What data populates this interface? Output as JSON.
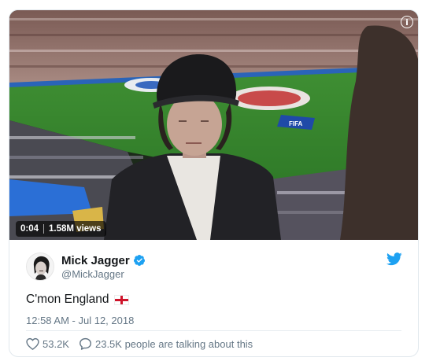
{
  "video": {
    "duration": "0:04",
    "views": "1.58M views",
    "info_icon": "info-icon",
    "banner_text": "FIFA"
  },
  "author": {
    "display_name": "Mick Jagger",
    "handle": "@MickJagger",
    "verified": true,
    "verified_color": "#1da1f2"
  },
  "tweet": {
    "text": "C'mon England",
    "emoji": "england-flag",
    "timestamp": "12:58 AM - Jul 12, 2018"
  },
  "actions": {
    "likes": "53.2K",
    "talking": "23.5K people are talking about this"
  },
  "colors": {
    "brand": "#1da1f2",
    "secondary_text": "#657786",
    "border": "#e1e8ed",
    "flag_red": "#cf142b"
  }
}
